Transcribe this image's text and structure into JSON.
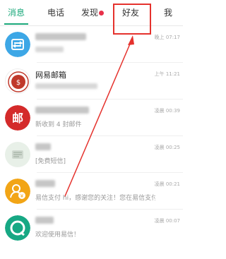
{
  "tabs": [
    {
      "label": "消息",
      "active": true
    },
    {
      "label": "电话",
      "active": false
    },
    {
      "label": "发现",
      "active": false,
      "has_badge_dot": true
    },
    {
      "label": "好友",
      "active": false,
      "highlighted": true
    },
    {
      "label": "我",
      "active": false
    }
  ],
  "colors": {
    "accent": "#1aa87a",
    "badge": "#e8314a",
    "annotation": "#e5322d"
  },
  "conversations": [
    {
      "name": "",
      "preview": "",
      "time": "晚上 07:17",
      "avatar": "blue-square-icon"
    },
    {
      "name": "网易邮箱",
      "preview": "",
      "time": "上午 11:21",
      "avatar": "netease-mail-seal-icon"
    },
    {
      "name": "",
      "preview": "新收到 4 封邮件",
      "time": "凌晨 00:39",
      "avatar": "mail-character-icon"
    },
    {
      "name": "",
      "preview": "[免费短信]",
      "time": "凌晨 00:25",
      "avatar": "sms-icon"
    },
    {
      "name": "",
      "preview": "易信支付 hi，感谢您的关注！您在易信支付遇",
      "time": "凌晨 00:21",
      "avatar": "yixin-pay-icon"
    },
    {
      "name": "",
      "preview": "欢迎使用易信！",
      "time": "凌晨 00:07",
      "avatar": "yixin-logo-icon"
    }
  ]
}
